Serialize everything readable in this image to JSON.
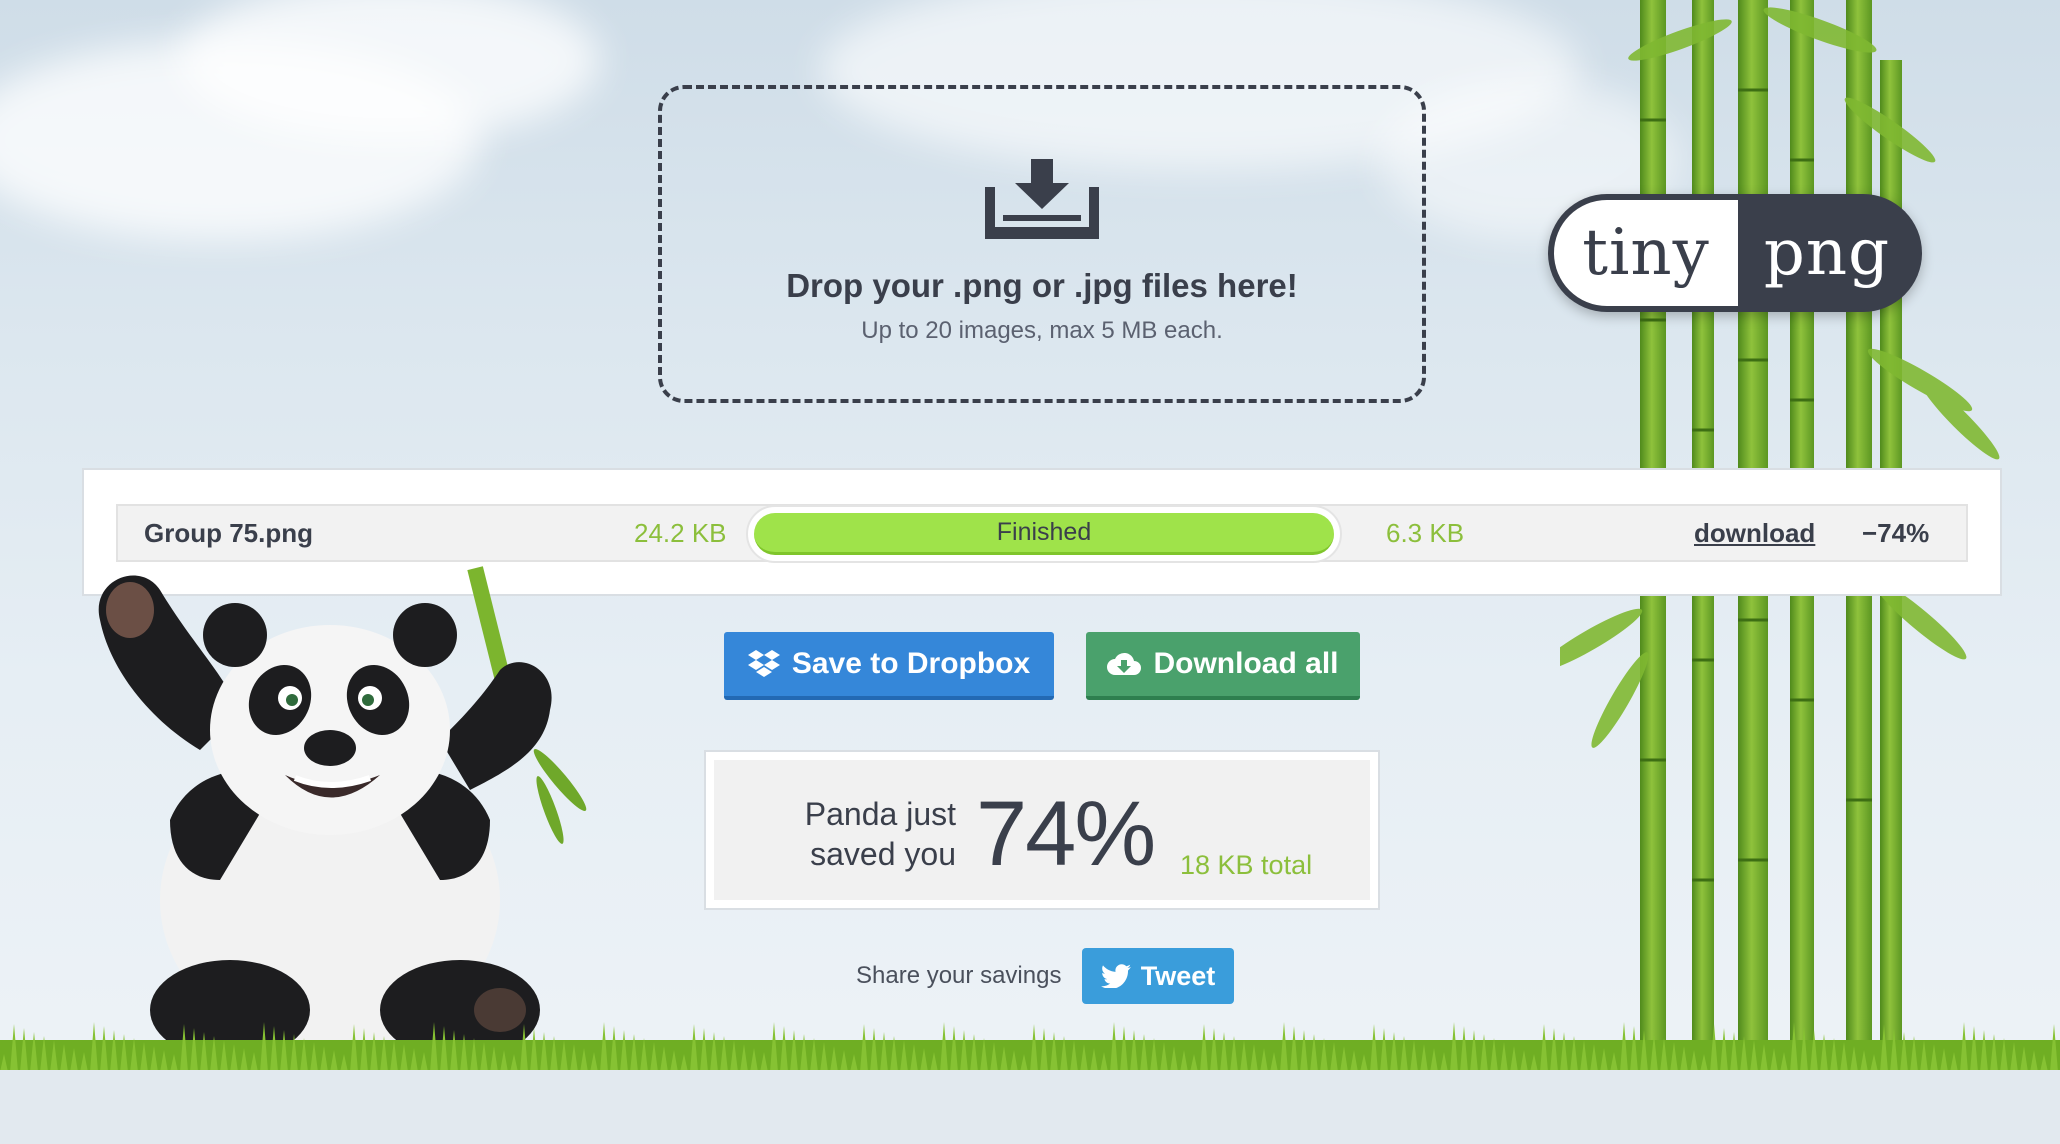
{
  "dropzone": {
    "title": "Drop your .png or .jpg files here!",
    "subtitle": "Up to 20 images, max 5 MB each.",
    "icon": "download-tray-icon"
  },
  "logo": {
    "left": "tiny",
    "right": "png"
  },
  "files": [
    {
      "name": "Group 75.png",
      "original_size": "24.2 KB",
      "status": "Finished",
      "progress": 1.0,
      "compressed_size": "6.3 KB",
      "download_label": "download",
      "reduction": "−74%"
    }
  ],
  "actions": {
    "dropbox_label": "Save to Dropbox",
    "download_all_label": "Download all"
  },
  "savings": {
    "label": "Panda just saved you",
    "label_line1": "Panda just",
    "label_line2": "saved you",
    "percent": "74%",
    "total": "18 KB total"
  },
  "share": {
    "label": "Share your savings",
    "tweet_label": "Tweet"
  },
  "colors": {
    "dark": "#3a3f4b",
    "green_text": "#8cbf3c",
    "progress": "#9fe34a",
    "dropbox_blue": "#3587d9",
    "download_green": "#4aa16c",
    "twitter_blue": "#3a9ddb"
  }
}
